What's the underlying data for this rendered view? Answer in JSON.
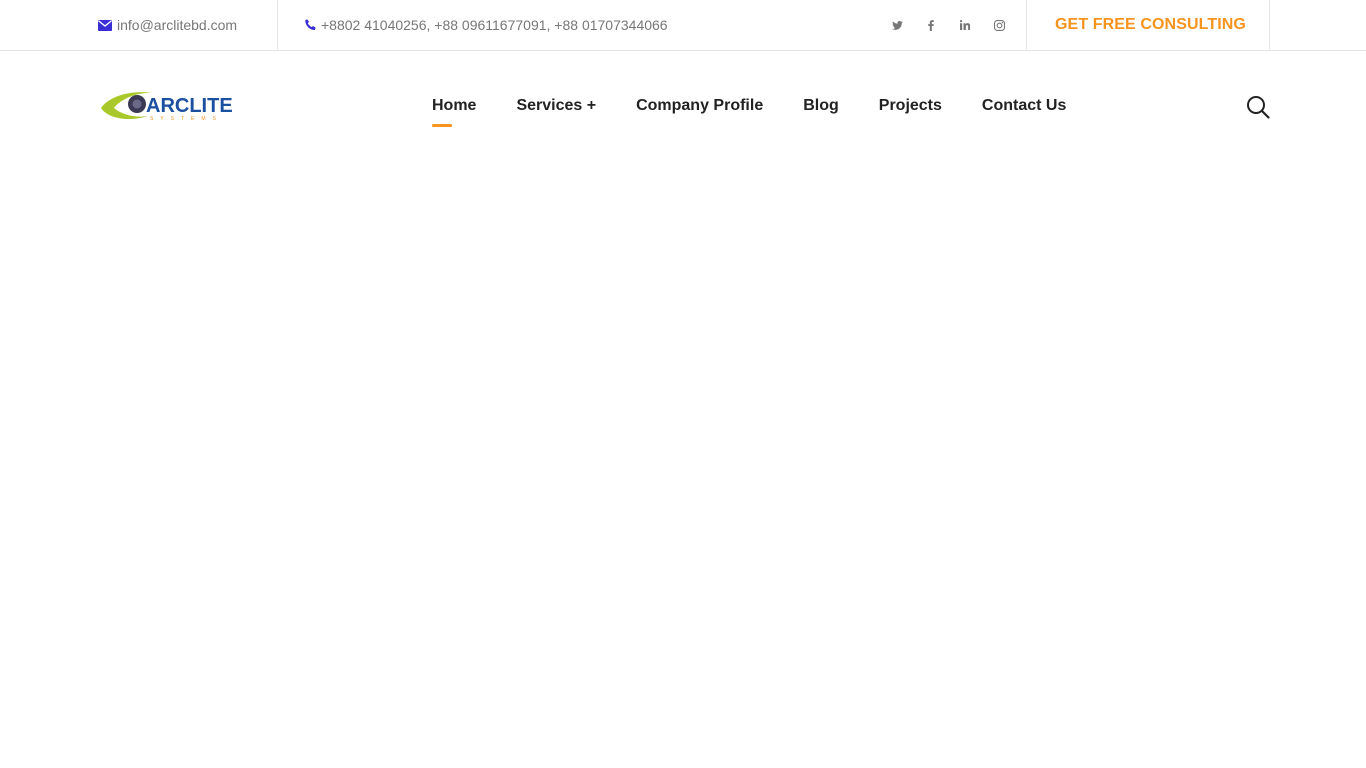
{
  "topbar": {
    "email": "info@arclitebd.com",
    "phone": "+8802 41040256, +88 09611677091, +88 01707344066",
    "social": [
      {
        "icon": "twitter-icon"
      },
      {
        "icon": "facebook-icon"
      },
      {
        "icon": "linkedin-icon"
      },
      {
        "icon": "instagram-icon"
      }
    ],
    "cta_label": "GET FREE CONSULTING"
  },
  "header": {
    "logo_text": "ARCLITE",
    "logo_subtext": "SYSTEMS",
    "nav": [
      {
        "label": "Home",
        "active": true
      },
      {
        "label": "Services +",
        "active": false
      },
      {
        "label": "Company Profile",
        "active": false
      },
      {
        "label": "Blog",
        "active": false
      },
      {
        "label": "Projects",
        "active": false
      },
      {
        "label": "Contact Us",
        "active": false
      }
    ]
  },
  "colors": {
    "accent": "#f7941d",
    "icon_blue": "#3a2fd6",
    "logo_green": "#a9c92b",
    "logo_blue": "#1b4fa0"
  }
}
